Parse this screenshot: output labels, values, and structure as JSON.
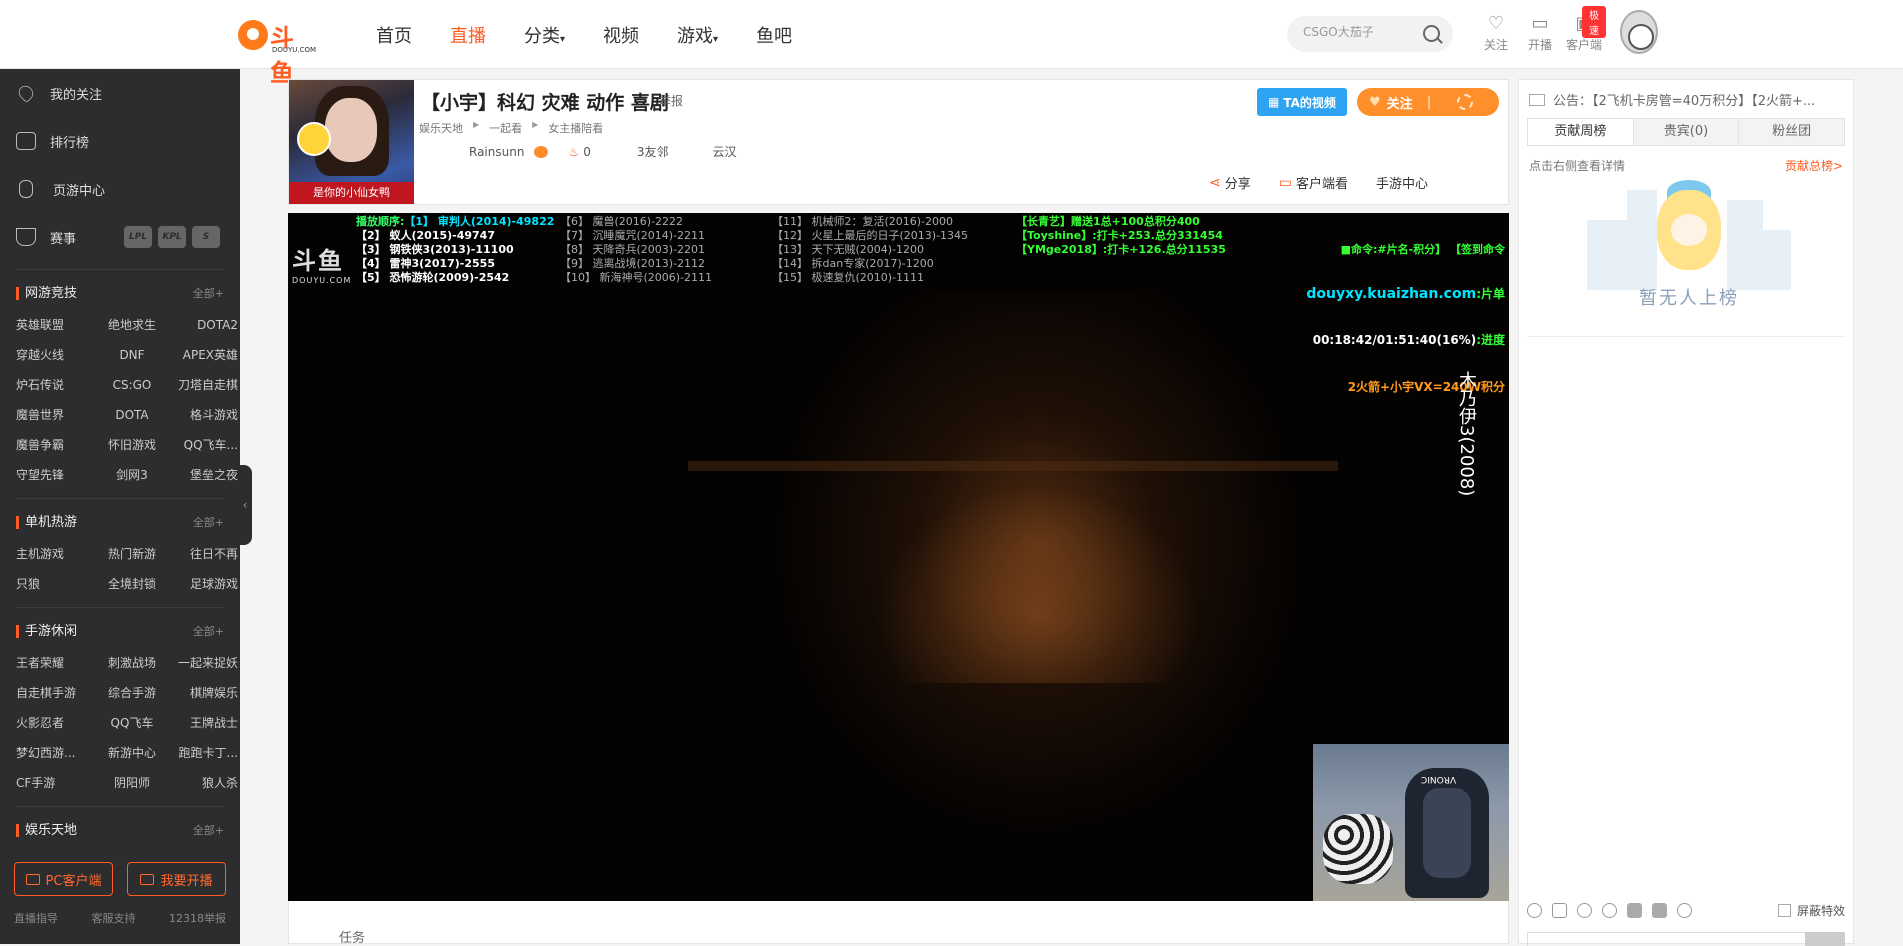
{
  "nav": {
    "logo_text": "斗鱼",
    "logo_sub": "DOUYU.COM",
    "links": [
      "首页",
      "直播",
      "分类",
      "视频",
      "游戏",
      "鱼吧"
    ],
    "active": "直播",
    "search_placeholder": "CSGO大茄子",
    "icons": [
      {
        "icon": "heart-icon",
        "label": "关注"
      },
      {
        "icon": "camera-icon",
        "label": "开播"
      },
      {
        "icon": "client-icon",
        "label": "客户端"
      }
    ],
    "badge": "极速"
  },
  "sidebar": {
    "top_items": [
      {
        "icon": "heart-icon",
        "label": "我的关注"
      },
      {
        "icon": "rank-icon",
        "label": "排行榜"
      },
      {
        "icon": "phone-icon",
        "label": "页游中心"
      },
      {
        "icon": "trophy-icon",
        "label": "赛事"
      }
    ],
    "league_logos": [
      "LPL",
      "KPL",
      "S"
    ],
    "sections": [
      {
        "title": "网游竞技",
        "more": "全部+",
        "tags": [
          "英雄联盟",
          "绝地求生",
          "DOTA2",
          "穿越火线",
          "DNF",
          "APEX英雄",
          "炉石传说",
          "CS:GO",
          "刀塔自走棋",
          "魔兽世界",
          "DOTA",
          "格斗游戏",
          "魔兽争霸",
          "怀旧游戏",
          "QQ飞车...",
          "守望先锋",
          "剑网3",
          "堡垒之夜"
        ]
      },
      {
        "title": "单机热游",
        "more": "全部+",
        "tags": [
          "主机游戏",
          "热门新游",
          "往日不再",
          "只狼",
          "全境封锁",
          "足球游戏"
        ]
      },
      {
        "title": "手游休闲",
        "more": "全部+",
        "tags": [
          "王者荣耀",
          "刺激战场",
          "一起来捉妖",
          "自走棋手游",
          "综合手游",
          "棋牌娱乐",
          "火影忍者",
          "QQ飞车",
          "王牌战士",
          "梦幻西游...",
          "新游中心",
          "跑跑卡丁...",
          " CF手游",
          "阴阳师",
          "狼人杀"
        ]
      },
      {
        "title": "娱乐天地",
        "more": "全部+",
        "tags": []
      }
    ],
    "btn_pc": "PC客户端",
    "btn_live": "我要开播",
    "footer": [
      "直播指导",
      "客服支持",
      "12318举报"
    ]
  },
  "room": {
    "avatar_caption": "是你的小仙女鸭",
    "title": "【小宇】科幻 灾难 动作 喜剧",
    "report": "举报",
    "crumbs": [
      "娱乐天地",
      "一起看",
      "女主播陪看"
    ],
    "anchor": "Rainsunn",
    "heat": "0",
    "friends": "3友邻",
    "guild": "云汉",
    "ta_video": "TA的视频",
    "follow": "关注",
    "actions": [
      "分享",
      "客户端看",
      "手游中心"
    ]
  },
  "video": {
    "list1_label": "播放顺序:",
    "list1": [
      "【1】 审判人(2014)-49822",
      "【2】 蚁人(2015)-49747",
      "【3】 钢铁侠3(2013)-11100",
      "【4】 雷神3(2017)-2555",
      "【5】 恐怖游轮(2009)-2542"
    ],
    "list2": [
      "【6】 魔兽(2016)-2222",
      "【7】 沉睡魔咒(2014)-2211",
      "【8】 天降奇兵(2003)-2201",
      "【9】 逃离战境(2013)-2112",
      "【10】 新海神号(2006)-2111"
    ],
    "list3": [
      "【11】 机械师2：复活(2016)-2000",
      "【12】 火星上最后的日子(2013)-1345",
      "【13】 天下无贼(2004)-1200",
      "【14】 拆dan专家(2017)-1200",
      "【15】 极速复仇(2010)-1111"
    ],
    "green": [
      "【长青艺】赠送1总+100总积分400",
      "【Toyshine】:打卡+253.总分331454",
      "【YMge2018】:打卡+126.总分11535"
    ],
    "right_l1": "■命令:#片名-积分】 【签到命令",
    "right_url": "douyxy.kuaizhan.com",
    "right_url_suffix": ":片单",
    "right_time": "00:18:42/01:51:40(16%)",
    "right_time_suffix": ":进度",
    "right_promo": "2火箭+小宇VX=240W积分",
    "logo_a": "斗鱼",
    "logo_b": "DOUYU.COM",
    "movie_title": "木乃伊3(2008)",
    "cam_label": "VRONIC"
  },
  "task": "任务",
  "panel": {
    "notice": "公告：【2飞机卡房管=40万积分】【2火箭+...",
    "tabs": [
      "贡献周榜",
      "贵宾(0)",
      "粉丝团"
    ],
    "hint": "点击右侧查看详情",
    "total": "贡献总榜>",
    "empty": "暂无人上榜",
    "mute_effects": "屏蔽特效"
  }
}
